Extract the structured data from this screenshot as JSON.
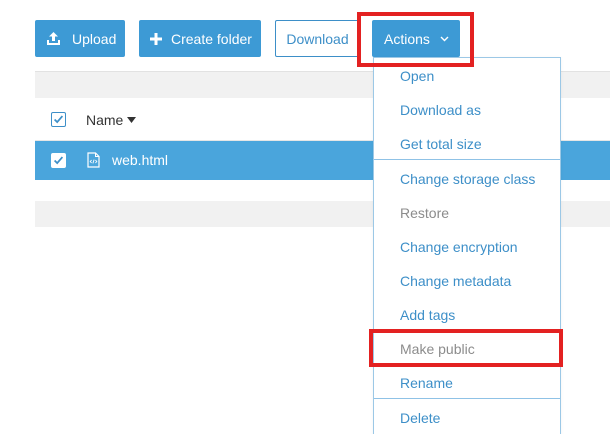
{
  "toolbar": {
    "upload_label": "Upload",
    "create_folder_label": "Create folder",
    "download_label": "Download",
    "actions_label": "Actions"
  },
  "table": {
    "header": {
      "name_label": "Name",
      "select_all_checked": true
    },
    "rows": [
      {
        "name": "web.html",
        "selected": true
      }
    ]
  },
  "actions_menu": {
    "groups": [
      [
        {
          "label": "Open",
          "enabled": true
        },
        {
          "label": "Download as",
          "enabled": true
        },
        {
          "label": "Get total size",
          "enabled": true
        }
      ],
      [
        {
          "label": "Change storage class",
          "enabled": true
        },
        {
          "label": "Restore",
          "enabled": false
        },
        {
          "label": "Change encryption",
          "enabled": true
        },
        {
          "label": "Change metadata",
          "enabled": true
        },
        {
          "label": "Add tags",
          "enabled": true
        },
        {
          "label": "Make public",
          "enabled": false
        },
        {
          "label": "Rename",
          "enabled": true
        }
      ],
      [
        {
          "label": "Delete",
          "enabled": true
        }
      ]
    ]
  },
  "colors": {
    "primary": "#3d9ad5",
    "link": "#3d8fc8",
    "selected_row": "#4aa5dc",
    "highlight": "#e32121",
    "disabled_text": "#8c8c8c"
  },
  "icons": {
    "upload": "upload-icon",
    "create_folder": "plus-icon",
    "actions": "chevron-down-icon",
    "sort": "caret-down-icon",
    "file": "html-file-icon"
  }
}
